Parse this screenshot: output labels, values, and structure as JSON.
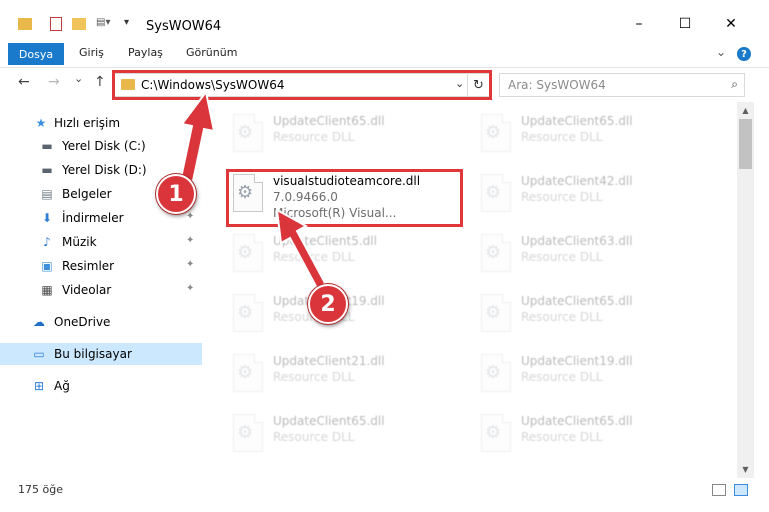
{
  "window": {
    "title": "SysWOW64",
    "minimize": "–",
    "maximize": "☐",
    "close": "✕"
  },
  "ribbon": {
    "tabs": [
      "Dosya",
      "Giriş",
      "Paylaş",
      "Görünüm"
    ],
    "expand": "⌄",
    "help": "?"
  },
  "nav": {
    "back": "←",
    "forward": "→",
    "recent": "⌄",
    "up": "↑"
  },
  "address": {
    "path": "C:\\Windows\\SysWOW64",
    "dropdown": "⌄",
    "refresh": "↻"
  },
  "search": {
    "placeholder": "Ara: SysWOW64",
    "icon": "⌕"
  },
  "sidebar": {
    "items": [
      {
        "label": "Hızlı erişim",
        "icon": "star-icon",
        "glyph": "★",
        "color": "#3b8fdc"
      },
      {
        "label": "Yerel Disk (C:)",
        "icon": "drive-icon",
        "glyph": "▬",
        "color": "#5a6470"
      },
      {
        "label": "Yerel Disk (D:)",
        "icon": "drive-icon",
        "glyph": "▬",
        "color": "#5a6470"
      },
      {
        "label": "Belgeler",
        "icon": "documents-icon",
        "glyph": "▤",
        "color": "#6d7985"
      },
      {
        "label": "İndirmeler",
        "icon": "download-icon",
        "glyph": "⬇",
        "color": "#2f7fd6"
      },
      {
        "label": "Müzik",
        "icon": "music-icon",
        "glyph": "♪",
        "color": "#2f7fd6"
      },
      {
        "label": "Resimler",
        "icon": "pictures-icon",
        "glyph": "▣",
        "color": "#3b8fdc"
      },
      {
        "label": "Videolar",
        "icon": "videos-icon",
        "glyph": "▦",
        "color": "#4a4a4a"
      },
      {
        "label": "OneDrive",
        "icon": "cloud-icon",
        "glyph": "☁",
        "color": "#1f6fc4"
      },
      {
        "label": "Bu bilgisayar",
        "icon": "computer-icon",
        "glyph": "▭",
        "color": "#2f7fd6"
      },
      {
        "label": "Ağ",
        "icon": "network-icon",
        "glyph": "⊞",
        "color": "#2f7fd6"
      }
    ],
    "pin": "📌"
  },
  "files": {
    "highlighted": {
      "name": "visualstudioteamcore.dll",
      "version": "7.0.9466.0",
      "company": "Microsoft(R) Visual..."
    },
    "faded": [
      {
        "name": "UpdateClient65.dll",
        "type": "Resource DLL"
      },
      {
        "name": "UpdateClient65.dll",
        "type": "Resource DLL"
      },
      {
        "name": "UpdateClient42.dll",
        "type": "Resource DLL"
      },
      {
        "name": "UpdateClient5.dll",
        "type": "Resource DLL"
      },
      {
        "name": "UpdateClient63.dll",
        "type": "Resource DLL"
      },
      {
        "name": "UpdateClient19.dll",
        "type": "Resource DLL"
      },
      {
        "name": "UpdateClient65.dll",
        "type": "Resource DLL"
      },
      {
        "name": "UpdateClient21.dll",
        "type": "Resource DLL"
      },
      {
        "name": "UpdateClient19.dll",
        "type": "Resource DLL"
      },
      {
        "name": "UpdateClient65.dll",
        "type": "Resource DLL"
      },
      {
        "name": "UpdateClient65.dll",
        "type": "Resource DLL"
      }
    ]
  },
  "status": {
    "count": "175 öğe"
  },
  "annotations": {
    "step1": "1",
    "step2": "2",
    "color": "#d9353a"
  }
}
